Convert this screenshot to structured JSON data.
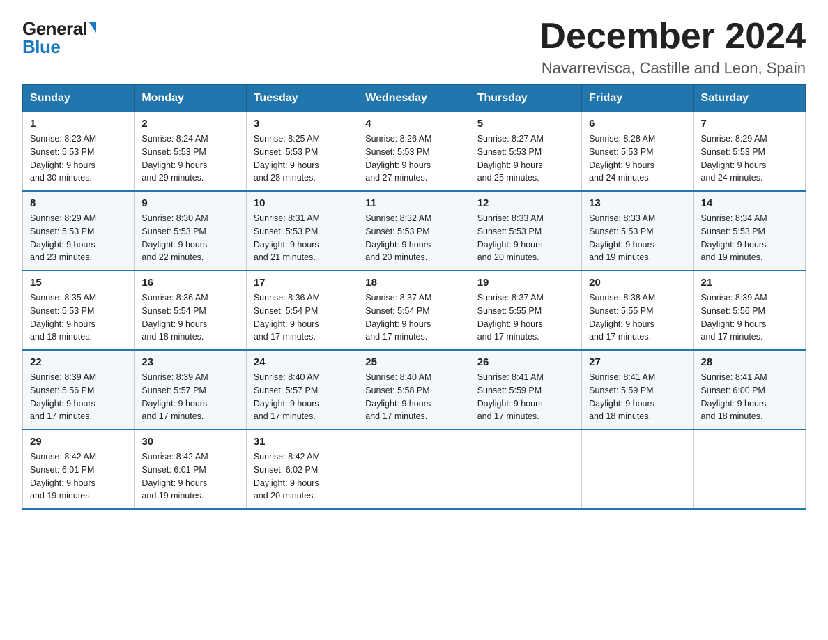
{
  "logo": {
    "general": "General",
    "blue": "Blue",
    "triangle": "▶"
  },
  "title": "December 2024",
  "location": "Navarrevisca, Castille and Leon, Spain",
  "days_of_week": [
    "Sunday",
    "Monday",
    "Tuesday",
    "Wednesday",
    "Thursday",
    "Friday",
    "Saturday"
  ],
  "weeks": [
    [
      {
        "day": "1",
        "sunrise": "8:23 AM",
        "sunset": "5:53 PM",
        "daylight": "9 hours and 30 minutes."
      },
      {
        "day": "2",
        "sunrise": "8:24 AM",
        "sunset": "5:53 PM",
        "daylight": "9 hours and 29 minutes."
      },
      {
        "day": "3",
        "sunrise": "8:25 AM",
        "sunset": "5:53 PM",
        "daylight": "9 hours and 28 minutes."
      },
      {
        "day": "4",
        "sunrise": "8:26 AM",
        "sunset": "5:53 PM",
        "daylight": "9 hours and 27 minutes."
      },
      {
        "day": "5",
        "sunrise": "8:27 AM",
        "sunset": "5:53 PM",
        "daylight": "9 hours and 25 minutes."
      },
      {
        "day": "6",
        "sunrise": "8:28 AM",
        "sunset": "5:53 PM",
        "daylight": "9 hours and 24 minutes."
      },
      {
        "day": "7",
        "sunrise": "8:29 AM",
        "sunset": "5:53 PM",
        "daylight": "9 hours and 24 minutes."
      }
    ],
    [
      {
        "day": "8",
        "sunrise": "8:29 AM",
        "sunset": "5:53 PM",
        "daylight": "9 hours and 23 minutes."
      },
      {
        "day": "9",
        "sunrise": "8:30 AM",
        "sunset": "5:53 PM",
        "daylight": "9 hours and 22 minutes."
      },
      {
        "day": "10",
        "sunrise": "8:31 AM",
        "sunset": "5:53 PM",
        "daylight": "9 hours and 21 minutes."
      },
      {
        "day": "11",
        "sunrise": "8:32 AM",
        "sunset": "5:53 PM",
        "daylight": "9 hours and 20 minutes."
      },
      {
        "day": "12",
        "sunrise": "8:33 AM",
        "sunset": "5:53 PM",
        "daylight": "9 hours and 20 minutes."
      },
      {
        "day": "13",
        "sunrise": "8:33 AM",
        "sunset": "5:53 PM",
        "daylight": "9 hours and 19 minutes."
      },
      {
        "day": "14",
        "sunrise": "8:34 AM",
        "sunset": "5:53 PM",
        "daylight": "9 hours and 19 minutes."
      }
    ],
    [
      {
        "day": "15",
        "sunrise": "8:35 AM",
        "sunset": "5:53 PM",
        "daylight": "9 hours and 18 minutes."
      },
      {
        "day": "16",
        "sunrise": "8:36 AM",
        "sunset": "5:54 PM",
        "daylight": "9 hours and 18 minutes."
      },
      {
        "day": "17",
        "sunrise": "8:36 AM",
        "sunset": "5:54 PM",
        "daylight": "9 hours and 17 minutes."
      },
      {
        "day": "18",
        "sunrise": "8:37 AM",
        "sunset": "5:54 PM",
        "daylight": "9 hours and 17 minutes."
      },
      {
        "day": "19",
        "sunrise": "8:37 AM",
        "sunset": "5:55 PM",
        "daylight": "9 hours and 17 minutes."
      },
      {
        "day": "20",
        "sunrise": "8:38 AM",
        "sunset": "5:55 PM",
        "daylight": "9 hours and 17 minutes."
      },
      {
        "day": "21",
        "sunrise": "8:39 AM",
        "sunset": "5:56 PM",
        "daylight": "9 hours and 17 minutes."
      }
    ],
    [
      {
        "day": "22",
        "sunrise": "8:39 AM",
        "sunset": "5:56 PM",
        "daylight": "9 hours and 17 minutes."
      },
      {
        "day": "23",
        "sunrise": "8:39 AM",
        "sunset": "5:57 PM",
        "daylight": "9 hours and 17 minutes."
      },
      {
        "day": "24",
        "sunrise": "8:40 AM",
        "sunset": "5:57 PM",
        "daylight": "9 hours and 17 minutes."
      },
      {
        "day": "25",
        "sunrise": "8:40 AM",
        "sunset": "5:58 PM",
        "daylight": "9 hours and 17 minutes."
      },
      {
        "day": "26",
        "sunrise": "8:41 AM",
        "sunset": "5:59 PM",
        "daylight": "9 hours and 17 minutes."
      },
      {
        "day": "27",
        "sunrise": "8:41 AM",
        "sunset": "5:59 PM",
        "daylight": "9 hours and 18 minutes."
      },
      {
        "day": "28",
        "sunrise": "8:41 AM",
        "sunset": "6:00 PM",
        "daylight": "9 hours and 18 minutes."
      }
    ],
    [
      {
        "day": "29",
        "sunrise": "8:42 AM",
        "sunset": "6:01 PM",
        "daylight": "9 hours and 19 minutes."
      },
      {
        "day": "30",
        "sunrise": "8:42 AM",
        "sunset": "6:01 PM",
        "daylight": "9 hours and 19 minutes."
      },
      {
        "day": "31",
        "sunrise": "8:42 AM",
        "sunset": "6:02 PM",
        "daylight": "9 hours and 20 minutes."
      },
      null,
      null,
      null,
      null
    ]
  ],
  "labels": {
    "sunrise": "Sunrise:",
    "sunset": "Sunset:",
    "daylight": "Daylight:"
  }
}
